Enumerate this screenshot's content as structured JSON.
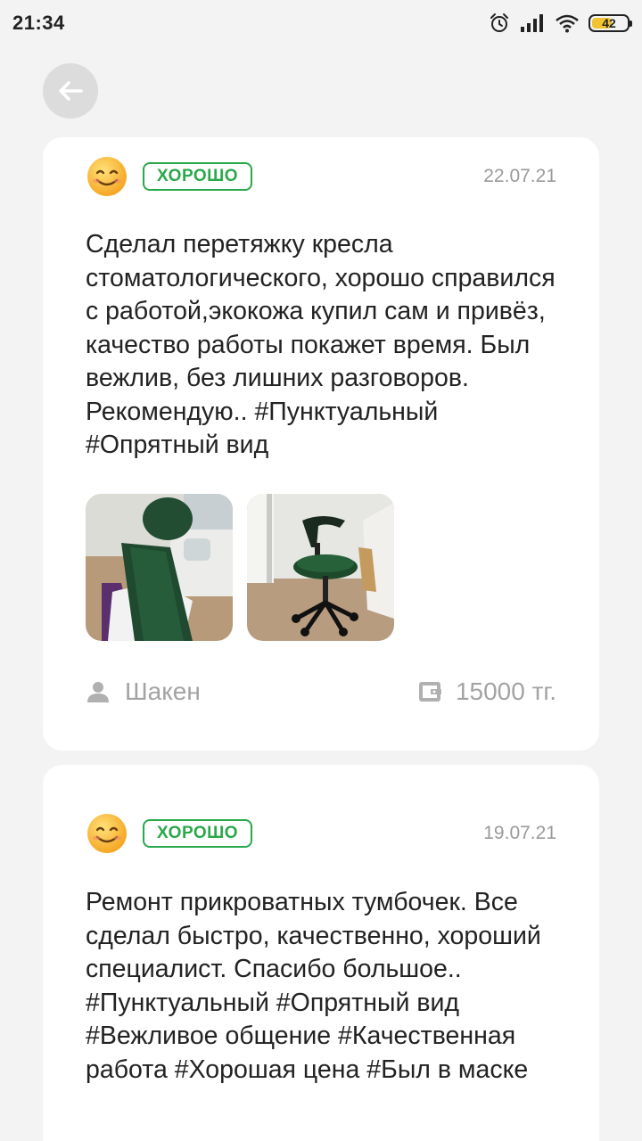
{
  "status_bar": {
    "time": "21:34",
    "battery_level": "42",
    "icons": [
      "alarm-icon",
      "signal-icon",
      "wifi-icon",
      "battery-icon"
    ]
  },
  "navigation": {
    "back_icon": "arrow-left-icon"
  },
  "colors": {
    "accent_green": "#2aa84a",
    "muted_text": "#9a9a9a",
    "background": "#f3f3f3",
    "card": "#ffffff"
  },
  "reviews": [
    {
      "emoji": "smiling-face-icon",
      "rating": "ХОРОШО",
      "date": "22.07.21",
      "text": "Сделал перетяжку кресла стоматологического, хорошо справился с работой,экокожа купил сам и привёз,  качество работы покажет время. Был вежлив, без лишних разговоров. Рекомендую.. #Пунктуальный #Опрятный вид",
      "photos": [
        "dental-chair-photo",
        "stool-chair-photo"
      ],
      "author": "Шакен",
      "price": "15000 тг."
    },
    {
      "emoji": "smiling-face-icon",
      "rating": "ХОРОШО",
      "date": "19.07.21",
      "text": "Ремонт прикроватных тумбочек. Все сделал быстро, качественно, хороший специалист. Спасибо большое..  #Пунктуальный #Опрятный вид #Вежливое общение #Качественная работа #Хорошая цена #Был в маске"
    }
  ]
}
